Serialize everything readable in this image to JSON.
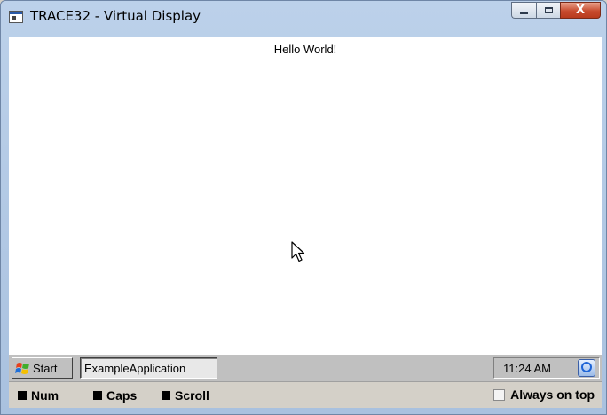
{
  "window": {
    "title": "TRACE32 - Virtual Display",
    "caption_buttons": {
      "minimize_icon": "minimize-icon",
      "maximize_icon": "maximize-icon",
      "close_glyph": "X"
    }
  },
  "display": {
    "text": "Hello World!"
  },
  "taskbar": {
    "start_label": "Start",
    "app_label": "ExampleApplication",
    "clock": "11:24 AM"
  },
  "status": {
    "num": "Num",
    "caps": "Caps",
    "scroll": "Scroll",
    "always_on_top": "Always on top",
    "always_on_top_checked": false
  },
  "colors": {
    "title_bar": "#a9c1df",
    "close_button": "#c74b2e",
    "taskbar": "#c0c0c0"
  }
}
